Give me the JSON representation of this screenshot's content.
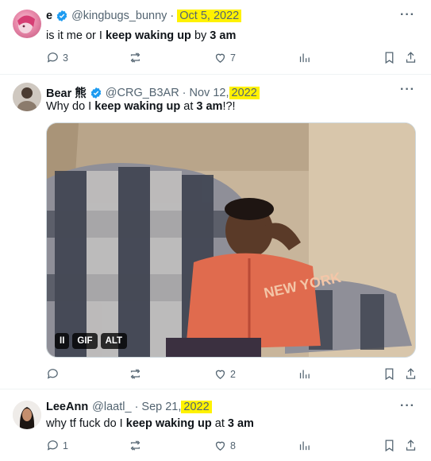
{
  "tweets": [
    {
      "display_name": "e",
      "handle": "@kingbugs_bunny",
      "date_prefix": "Oct 5, 2022",
      "date_year": "",
      "text_before": "is it me or I ",
      "text_bold": "keep waking up",
      "text_mid": " by ",
      "text_bold2": "3 am",
      "text_after": "",
      "replies": "3",
      "retweets": "",
      "likes": "7"
    },
    {
      "display_name": "Bear 熊",
      "handle": "@CRG_B3AR",
      "date_prefix": "Nov 12, ",
      "date_year": "2022",
      "text_before": "Why do I ",
      "text_bold": "keep waking up",
      "text_mid": " at ",
      "text_bold2": "3 am",
      "text_after": "!?!",
      "replies": "",
      "retweets": "",
      "likes": "2",
      "media": {
        "pause": "II",
        "gif": "GIF",
        "alt": "ALT",
        "jersey_text": "NEW YORK"
      }
    },
    {
      "display_name": "LeeAnn",
      "handle": "@laatl_",
      "date_prefix": "Sep 21, ",
      "date_year": "2022",
      "text_before": "why tf fuck do I ",
      "text_bold": "keep waking up",
      "text_mid": " at ",
      "text_bold2": "3 am",
      "text_after": "",
      "replies": "1",
      "retweets": "",
      "likes": "8"
    }
  ],
  "more_glyph": "···",
  "separator": "·",
  "colors": {
    "highlight": "#fff200",
    "verified": "#1d9bf0",
    "muted": "#536471"
  }
}
